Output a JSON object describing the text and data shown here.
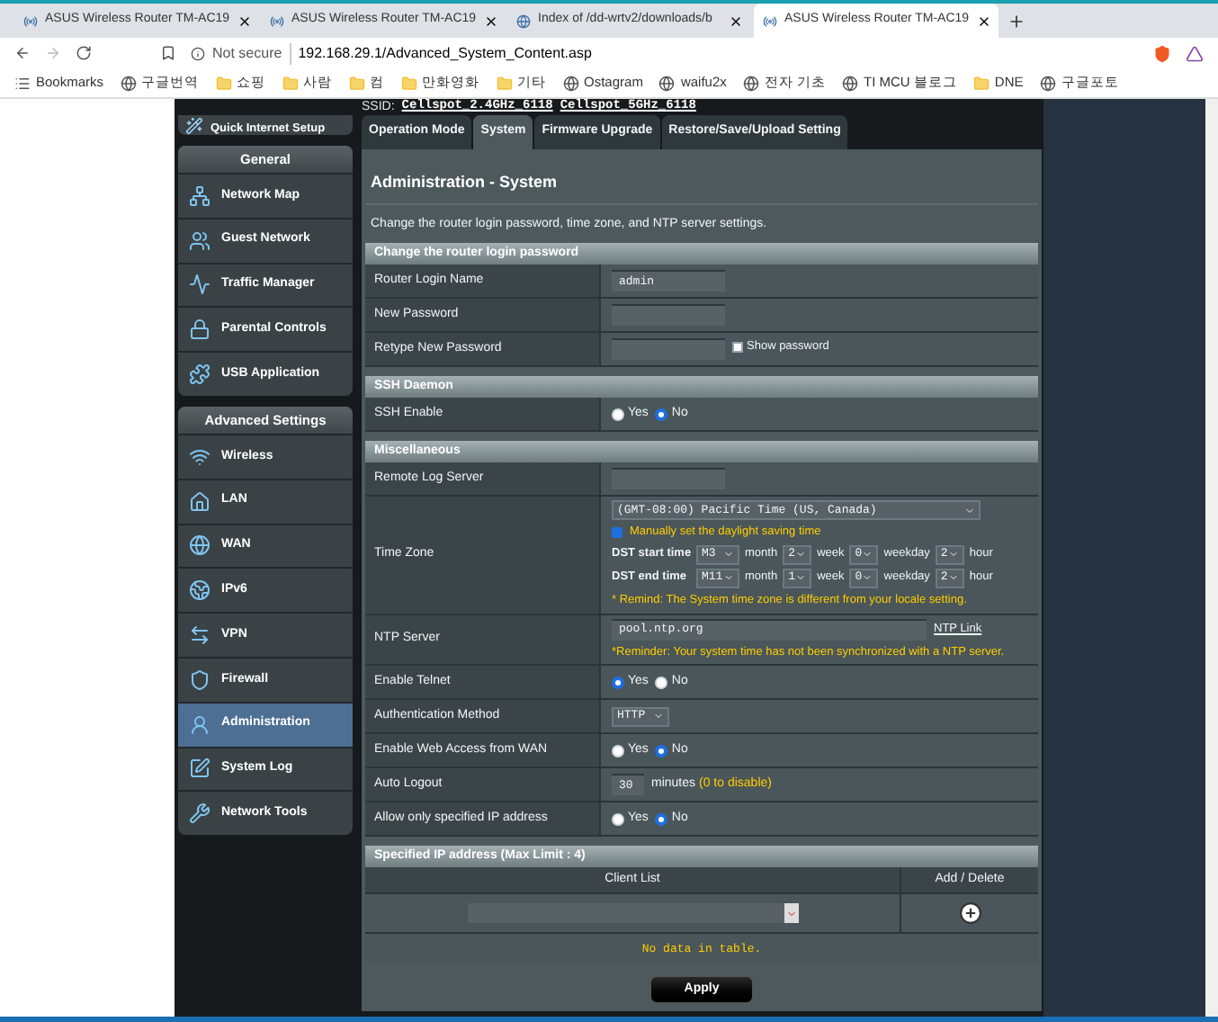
{
  "browser": {
    "tabs": [
      {
        "title": "ASUS Wireless Router TM-AC19",
        "kind": "router",
        "selected": false
      },
      {
        "title": "ASUS Wireless Router TM-AC19",
        "kind": "router",
        "selected": false
      },
      {
        "title": "Index of /dd-wrtv2/downloads/b",
        "kind": "globe",
        "selected": false
      },
      {
        "title": "ASUS Wireless Router TM-AC19",
        "kind": "router",
        "selected": true
      }
    ],
    "security": "Not secure",
    "url": "192.168.29.1/Advanced_System_Content.asp",
    "bookmarks": [
      {
        "label": "Bookmarks",
        "kind": "list"
      },
      {
        "label": "구글번역",
        "kind": "site"
      },
      {
        "label": "쇼핑",
        "kind": "folder"
      },
      {
        "label": "사람",
        "kind": "folder"
      },
      {
        "label": "컴",
        "kind": "folder"
      },
      {
        "label": "만화영화",
        "kind": "folder"
      },
      {
        "label": "기타",
        "kind": "folder"
      },
      {
        "label": "Ostagram",
        "kind": "site"
      },
      {
        "label": "waifu2x",
        "kind": "site"
      },
      {
        "label": "전자 기초",
        "kind": "site"
      },
      {
        "label": "TI MCU 블로그",
        "kind": "site"
      },
      {
        "label": "DNE",
        "kind": "folder"
      },
      {
        "label": "구글포토",
        "kind": "site"
      }
    ]
  },
  "ssid": {
    "label": "SSID:",
    "names": [
      "Cellspot_2.4GHz_6118",
      "Cellspot_5GHz_6118"
    ]
  },
  "sidebar": {
    "quick_setup": "Quick Internet Setup",
    "groups": [
      {
        "title": "General",
        "items": [
          {
            "label": "Network Map",
            "selected": false
          },
          {
            "label": "Guest Network",
            "selected": false
          },
          {
            "label": "Traffic Manager",
            "selected": false
          },
          {
            "label": "Parental Controls",
            "selected": false
          },
          {
            "label": "USB Application",
            "selected": false
          }
        ]
      },
      {
        "title": "Advanced Settings",
        "items": [
          {
            "label": "Wireless",
            "selected": false
          },
          {
            "label": "LAN",
            "selected": false
          },
          {
            "label": "WAN",
            "selected": false
          },
          {
            "label": "IPv6",
            "selected": false
          },
          {
            "label": "VPN",
            "selected": false
          },
          {
            "label": "Firewall",
            "selected": false
          },
          {
            "label": "Administration",
            "selected": true
          },
          {
            "label": "System Log",
            "selected": false
          },
          {
            "label": "Network Tools",
            "selected": false
          }
        ]
      }
    ]
  },
  "tabs": [
    {
      "label": "Operation Mode",
      "selected": false
    },
    {
      "label": "System",
      "selected": true
    },
    {
      "label": "Firmware Upgrade",
      "selected": false
    },
    {
      "label": "Restore/Save/Upload Setting",
      "selected": false
    }
  ],
  "title": "Administration - System",
  "description": "Change the router login password, time zone, and NTP server settings.",
  "sections": [
    {
      "title": "Change the router login password",
      "rows": [
        {
          "kind": "text",
          "label": "Router Login Name",
          "value": "admin"
        },
        {
          "kind": "password",
          "label": "New Password"
        },
        {
          "kind": "password",
          "label": "Retype New Password",
          "show": {
            "label": "Show password",
            "checked": false
          }
        }
      ]
    },
    {
      "title": "SSH Daemon",
      "rows": [
        {
          "kind": "radio",
          "label": "SSH Enable",
          "options": [
            {
              "label": "Yes",
              "selected": false
            },
            {
              "label": "No",
              "selected": true
            }
          ]
        }
      ]
    },
    {
      "title": "Miscellaneous",
      "rows": [
        {
          "kind": "text",
          "label": "Remote Log Server"
        },
        {
          "kind": "timezone",
          "label": "Time Zone",
          "value": "(GMT-08:00) Pacific Time (US, Canada)",
          "dst": {
            "label": "Manually set the daylight saving time",
            "checked": true
          },
          "dst_rows": [
            {
              "label": "DST start time",
              "fields": [
                {
                  "value": "M3",
                  "unit": "month"
                },
                {
                  "value": "2",
                  "unit": "week"
                },
                {
                  "value": "0",
                  "unit": "weekday"
                },
                {
                  "value": "2",
                  "unit": "hour"
                }
              ]
            },
            {
              "label": "DST end time",
              "fields": [
                {
                  "value": "M11",
                  "unit": "month"
                },
                {
                  "value": "1",
                  "unit": "week"
                },
                {
                  "value": "0",
                  "unit": "weekday"
                },
                {
                  "value": "2",
                  "unit": "hour"
                }
              ]
            }
          ],
          "remind": "* Remind: The System time zone is different from your locale setting."
        },
        {
          "kind": "ntp",
          "label": "NTP Server",
          "value": "pool.ntp.org",
          "link": "NTP Link",
          "note": "*Reminder: Your system time has not been synchronized with a NTP server."
        },
        {
          "kind": "radio",
          "label": "Enable Telnet",
          "options": [
            {
              "label": "Yes",
              "selected": true
            },
            {
              "label": "No",
              "selected": false
            }
          ]
        },
        {
          "kind": "select",
          "label": "Authentication Method",
          "value": "HTTP"
        },
        {
          "kind": "radio",
          "label": "Enable Web Access from WAN",
          "options": [
            {
              "label": "Yes",
              "selected": false
            },
            {
              "label": "No",
              "selected": true
            }
          ]
        },
        {
          "kind": "number",
          "label": "Auto Logout",
          "value": "30",
          "unit": "minutes",
          "hint": "(0 to disable)"
        },
        {
          "kind": "radio",
          "label": "Allow only specified IP address",
          "options": [
            {
              "label": "Yes",
              "selected": false
            },
            {
              "label": "No",
              "selected": true
            }
          ]
        }
      ]
    }
  ],
  "ip_table": {
    "title": "Specified IP address (Max Limit : 4)",
    "columns": [
      "Client List",
      "Add / Delete"
    ],
    "empty": "No data in table."
  },
  "apply": "Apply"
}
